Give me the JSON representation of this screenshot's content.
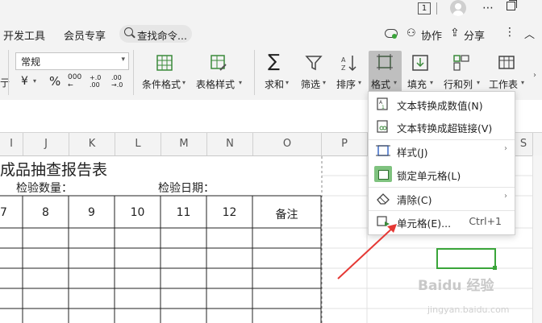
{
  "titlebar": {
    "page_badge": "1",
    "icons": [
      "more-icon",
      "restore-icon"
    ]
  },
  "menubar": {
    "items": [
      {
        "label": "开发工具"
      },
      {
        "label": "会员专享"
      }
    ],
    "search_label": "查找命令...",
    "right": {
      "collab": "协作",
      "share": "分享"
    }
  },
  "ribbon": {
    "number_format": "常规",
    "percent": "%",
    "currency": "¥",
    "thousands": "000",
    "dec_inc": "+.0 .00",
    "dec_dec": ".00 →.0",
    "buttons": [
      {
        "label": "条件格式"
      },
      {
        "label": "表格样式"
      },
      {
        "label": "求和"
      },
      {
        "label": "筛选"
      },
      {
        "label": "排序"
      },
      {
        "label": "格式"
      },
      {
        "label": "填充"
      },
      {
        "label": "行和列"
      },
      {
        "label": "工作表"
      }
    ]
  },
  "sheet": {
    "columns": [
      "I",
      "J",
      "K",
      "L",
      "M",
      "N",
      "O",
      "P",
      "S"
    ],
    "title": "成品抽查报告表",
    "row2": {
      "qty_label": "检验数量：",
      "date_label": "检验日期："
    },
    "row3": [
      "7",
      "8",
      "9",
      "10",
      "11",
      "12",
      "备注"
    ]
  },
  "format_menu": {
    "items": [
      {
        "label": "文本转换成数值(N)",
        "icon": "text-to-number-icon"
      },
      {
        "label": "文本转换成超链接(V)",
        "icon": "text-to-link-icon"
      },
      {
        "label": "样式(J)",
        "icon": "style-icon",
        "submenu": true
      },
      {
        "label": "锁定单元格(L)",
        "icon": "lock-cell-icon"
      },
      {
        "label": "清除(C)",
        "icon": "eraser-icon",
        "submenu": true
      },
      {
        "label": "单元格(E)...",
        "icon": "cell-format-icon",
        "shortcut": "Ctrl+1"
      }
    ]
  },
  "watermark": {
    "main": "Baidu 经验",
    "sub": "jingyan.baidu.com"
  },
  "colors": {
    "accent_green": "#3aa53a",
    "arrow_red": "#e53935",
    "selected_btn": "#bfbfbf"
  }
}
